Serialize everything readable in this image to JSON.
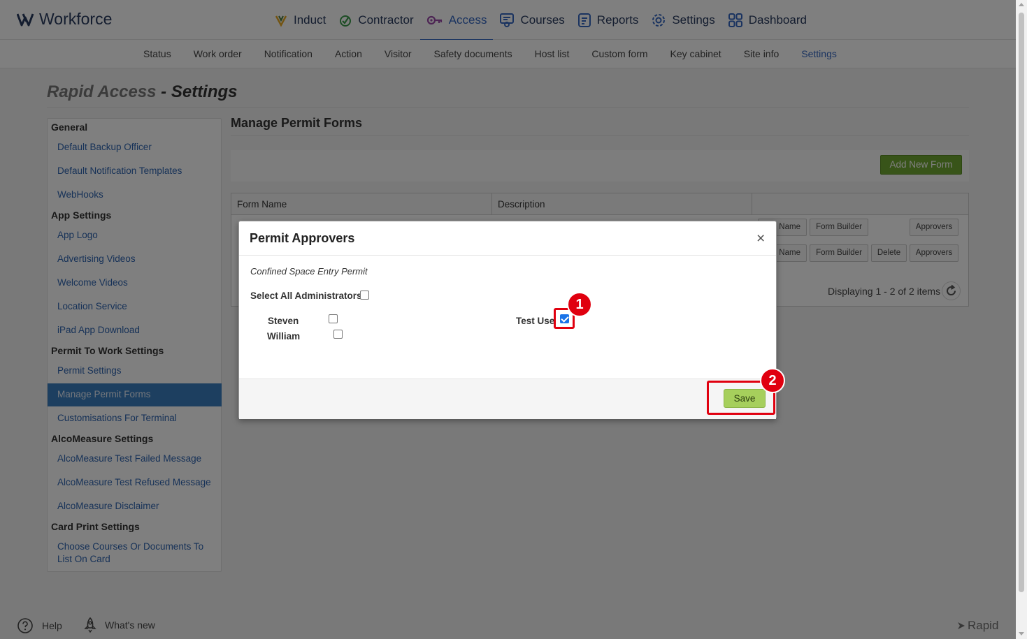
{
  "brand": {
    "name": "Workforce"
  },
  "nav": {
    "items": [
      {
        "label": "Induct",
        "icon": "induct-icon"
      },
      {
        "label": "Contractor",
        "icon": "contractor-icon"
      },
      {
        "label": "Access",
        "icon": "access-key-icon",
        "active": true
      },
      {
        "label": "Courses",
        "icon": "courses-icon"
      },
      {
        "label": "Reports",
        "icon": "reports-icon"
      },
      {
        "label": "Settings",
        "icon": "gear-icon"
      },
      {
        "label": "Dashboard",
        "icon": "dashboard-icon"
      }
    ]
  },
  "subnav": {
    "items": [
      "Status",
      "Work order",
      "Notification",
      "Action",
      "Visitor",
      "Safety documents",
      "Host list",
      "Custom form",
      "Key cabinet",
      "Site info",
      "Settings"
    ],
    "active": "Settings"
  },
  "page": {
    "title_part1": "Rapid Access",
    "title_part2": " - Settings"
  },
  "sidebar": {
    "general": "General",
    "default_backup_officer": "Default Backup Officer",
    "default_notification_templates": "Default Notification Templates",
    "webhooks": "WebHooks",
    "app_settings": "App Settings",
    "app_logo": "App Logo",
    "advertising_videos": "Advertising Videos",
    "welcome_videos": "Welcome Videos",
    "location_service": "Location Service",
    "ipad_app_download": "iPad App Download",
    "permit_to_work_settings": "Permit To Work Settings",
    "permit_settings": "Permit Settings",
    "manage_permit_forms": "Manage Permit Forms",
    "customisations_for_terminal": "Customisations For Terminal",
    "alcomeasure_settings": "AlcoMeasure Settings",
    "alco_failed": "AlcoMeasure Test Failed Message",
    "alco_refused": "AlcoMeasure Test Refused Message",
    "alco_disclaimer": "AlcoMeasure Disclaimer",
    "card_print_settings": "Card Print Settings",
    "choose_courses_line1": "Choose Courses Or Documents To",
    "choose_courses_line2": "List On Card"
  },
  "main": {
    "section_title": "Manage Permit Forms",
    "add_button": "Add New Form",
    "columns": [
      "Form Name",
      "Description"
    ],
    "row_buttons": {
      "edit_name_partial": "t Name",
      "form_builder": "Form Builder",
      "delete": "Delete",
      "approvers": "Approvers"
    },
    "paging": "Displaying 1 - 2 of 2 items"
  },
  "modal": {
    "title": "Permit Approvers",
    "close": "×",
    "form_name": "Confined Space Entry Permit",
    "select_all_label": "Select All Administrators",
    "select_all_checked": false,
    "approvers": [
      {
        "name": "Steven",
        "checked": false
      },
      {
        "name": "William",
        "checked": false
      },
      {
        "name": "Test User",
        "display": "Test Use",
        "checked": true
      }
    ],
    "save": "Save"
  },
  "annotations": {
    "step1": "1",
    "step2": "2",
    "color": "#e0000f"
  },
  "footer": {
    "help": "Help",
    "whats_new": "What's new",
    "brand": "Rapid"
  },
  "colors": {
    "accent": "#3467c1",
    "brand_navy": "#283a5e",
    "add_green": "#71a832",
    "save_green": "#a6cf5c",
    "sidebar_active": "#3a7fc1"
  }
}
